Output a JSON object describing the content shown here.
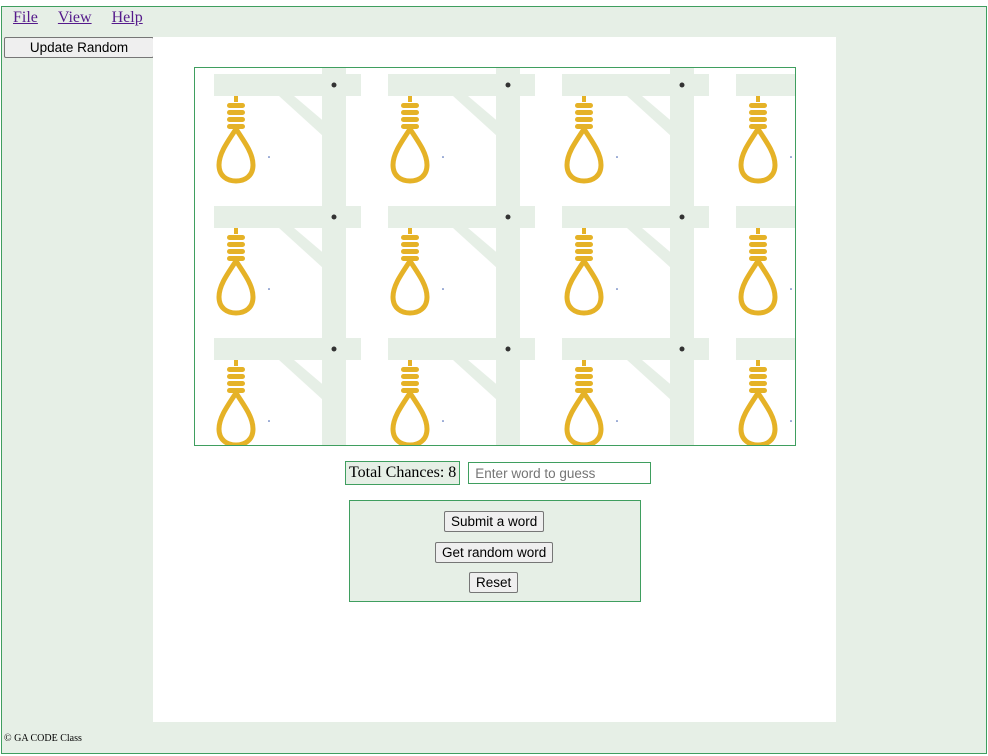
{
  "menu": {
    "file": "File",
    "view": "View",
    "help": "Help"
  },
  "sidebar": {
    "update_random_label": "Update Random"
  },
  "game": {
    "chances_label": "Total Chances: 8",
    "guess_placeholder": "Enter word to guess",
    "submit_label": "Submit a word",
    "random_label": "Get random word",
    "reset_label": "Reset"
  },
  "footer": {
    "copyright": "© GA CODE Class"
  },
  "colors": {
    "frame_bg": "#e6efe6",
    "border": "#3f9e5f",
    "rope": "#e5b227",
    "gallows": "#e6efe6"
  },
  "icons": {
    "board_tile": "hangman-noose-tile"
  }
}
